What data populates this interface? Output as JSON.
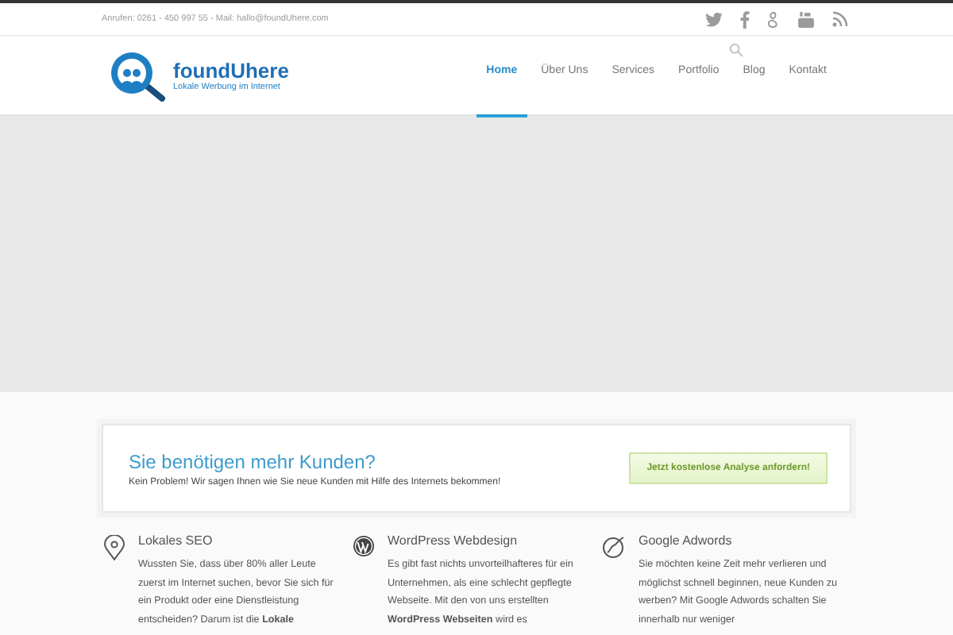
{
  "top_bar": {
    "contact": "Anrufen: 0261 - 450 997 55 - Mail: hallo@foundUhere.com"
  },
  "logo": {
    "name": "foundUhere",
    "tagline": "Lokale Werbung im Internet"
  },
  "nav": [
    {
      "label": "Home",
      "selected": true
    },
    {
      "label": "Über Uns",
      "selected": false
    },
    {
      "label": "Services",
      "selected": false
    },
    {
      "label": "Portfolio",
      "selected": false
    },
    {
      "label": "Blog",
      "selected": false
    },
    {
      "label": "Kontakt",
      "selected": false
    }
  ],
  "callout": {
    "title": "Sie benötigen mehr Kunden?",
    "text": "Kein Problem! Wir sagen Ihnen wie Sie neue Kunden mit Hilfe des Internets bekommen!",
    "button": "Jetzt kostenlose Analyse anfordern!"
  },
  "features": [
    {
      "kind": "pin",
      "title": "Lokales SEO",
      "text": "Wussten Sie, dass über 80% aller Leute zuerst im Internet suchen, bevor Sie sich für ein Produkt oder eine Dienstleistung entscheiden? Darum ist die **Lokale**"
    },
    {
      "kind": "wordpress",
      "title": "WordPress Webdesign",
      "text": "Es gibt fast nichts unvorteilhafteres für ein Unternehmen, als eine schlecht gepflegte Webseite. Mit den von uns erstellten **WordPress Webseiten** wird es"
    },
    {
      "kind": "chart",
      "title": "Google Adwords",
      "text": "Sie möchten keine Zeit mehr verlieren und möglichst schnell beginnen, neue Kunden zu werben? Mit Google Adwords schalten Sie innerhalb nur weniger"
    }
  ]
}
